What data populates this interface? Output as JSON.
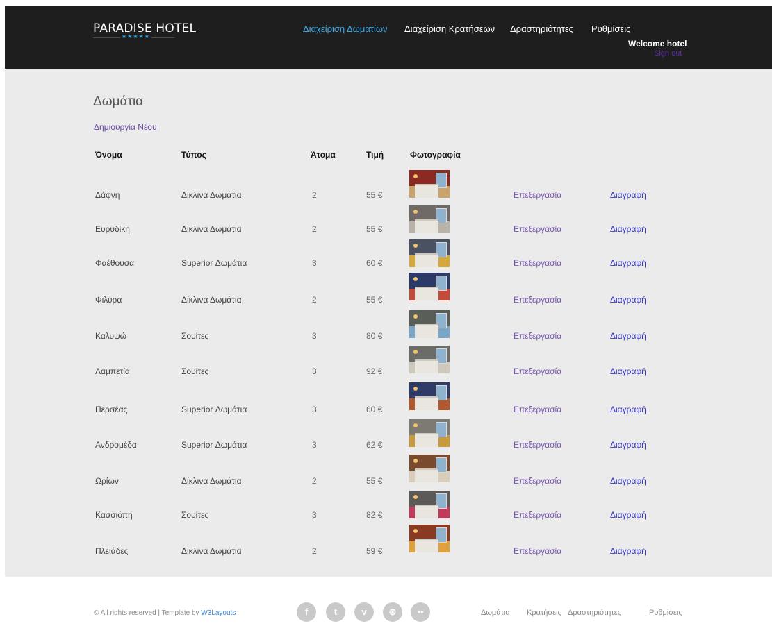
{
  "brand": {
    "name": "PARADISE HOTEL",
    "stars": "★★★★★"
  },
  "nav": {
    "items": [
      {
        "label": "Διαχείριση Δωματίων",
        "active": true
      },
      {
        "label": "Διαχείριση Κρατήσεων",
        "active": false
      },
      {
        "label": "Δραστηριότητες",
        "active": false
      },
      {
        "label": "Ρυθμίσεις",
        "active": false
      }
    ],
    "welcome": "Welcome hotel",
    "signout": "Sign out"
  },
  "page": {
    "title": "Δωμάτια",
    "create_link": "Δημιουργία Νέου"
  },
  "table": {
    "headers": [
      "Όνομα",
      "Τύπος",
      "Άτομα",
      "Τιμή",
      "Φωτογραφία"
    ],
    "rows": [
      {
        "name": "Δάφνη",
        "type": "Δίκλινα Δωμάτια",
        "persons": "2",
        "price": "55 €",
        "edit": "Επεξεργασία",
        "delete": "Διαγραφή",
        "photo_colors": [
          "#8a2a22",
          "#c9a36b"
        ]
      },
      {
        "name": "Ευρυδίκη",
        "type": "Δίκλινα Δωμάτια",
        "persons": "2",
        "price": "55 €",
        "edit": "Επεξεργασία",
        "delete": "Διαγραφή",
        "photo_colors": [
          "#6f6a66",
          "#b8b2a8"
        ]
      },
      {
        "name": "Φαέθουσα",
        "type": "Superior Δωμάτια",
        "persons": "3",
        "price": "60 €",
        "edit": "Επεξεργασία",
        "delete": "Διαγραφή",
        "photo_colors": [
          "#4a5262",
          "#d6a73a"
        ]
      },
      {
        "name": "Φιλύρα",
        "type": "Δίκλινα Δωμάτια",
        "persons": "2",
        "price": "55 €",
        "edit": "Επεξεργασία",
        "delete": "Διαγραφή",
        "photo_colors": [
          "#2c3a6a",
          "#c44a3a"
        ]
      },
      {
        "name": "Καλυψώ",
        "type": "Σουίτες",
        "persons": "3",
        "price": "80 €",
        "edit": "Επεξεργασία",
        "delete": "Διαγραφή",
        "photo_colors": [
          "#5a5e58",
          "#7aa6c8"
        ]
      },
      {
        "name": "Λαμπετία",
        "type": "Σουίτες",
        "persons": "3",
        "price": "92 €",
        "edit": "Επεξεργασία",
        "delete": "Διαγραφή",
        "photo_colors": [
          "#6b6b68",
          "#cfc9bd"
        ]
      },
      {
        "name": "Περσέας",
        "type": "Superior Δωμάτια",
        "persons": "3",
        "price": "60 €",
        "edit": "Επεξεργασία",
        "delete": "Διαγραφή",
        "photo_colors": [
          "#2f3a66",
          "#b2572e"
        ]
      },
      {
        "name": "Ανδρομέδα",
        "type": "Superior Δωμάτια",
        "persons": "3",
        "price": "62 €",
        "edit": "Επεξεργασία",
        "delete": "Διαγραφή",
        "photo_colors": [
          "#7d7a72",
          "#c79a3e"
        ]
      },
      {
        "name": "Ωρίων",
        "type": "Δίκλινα Δωμάτια",
        "persons": "2",
        "price": "55 €",
        "edit": "Επεξεργασία",
        "delete": "Διαγραφή",
        "photo_colors": [
          "#7a4a2e",
          "#d8cdb8"
        ]
      },
      {
        "name": "Κασσιόπη",
        "type": "Σουίτες",
        "persons": "3",
        "price": "82 €",
        "edit": "Επεξεργασία",
        "delete": "Διαγραφή",
        "photo_colors": [
          "#5c5a56",
          "#c23a5a"
        ]
      },
      {
        "name": "Πλειάδες",
        "type": "Δίκλινα Δωμάτια",
        "persons": "2",
        "price": "59 €",
        "edit": "Επεξεργασία",
        "delete": "Διαγραφή",
        "photo_colors": [
          "#8a3a22",
          "#e0a03a"
        ]
      }
    ]
  },
  "footer": {
    "copyright": "© All rights reserved | Template by",
    "brand_link": "W3Layouts",
    "social": [
      {
        "icon": "facebook-icon",
        "glyph": "f"
      },
      {
        "icon": "twitter-icon",
        "glyph": "t"
      },
      {
        "icon": "vimeo-icon",
        "glyph": "v"
      },
      {
        "icon": "dribbble-icon",
        "glyph": "⊛"
      },
      {
        "icon": "flickr-icon",
        "glyph": "••"
      }
    ],
    "links": [
      "Δωμάτια",
      "Κρατήσεις",
      "Δραστηριότητες",
      "Ρυθμίσεις"
    ]
  },
  "colors": {
    "topbar": "#1e1e1e",
    "content_bg": "#ebebeb",
    "nav_active": "#3aa8e6",
    "edit_link": "#7a55b8",
    "delete_link": "#3636c9"
  }
}
